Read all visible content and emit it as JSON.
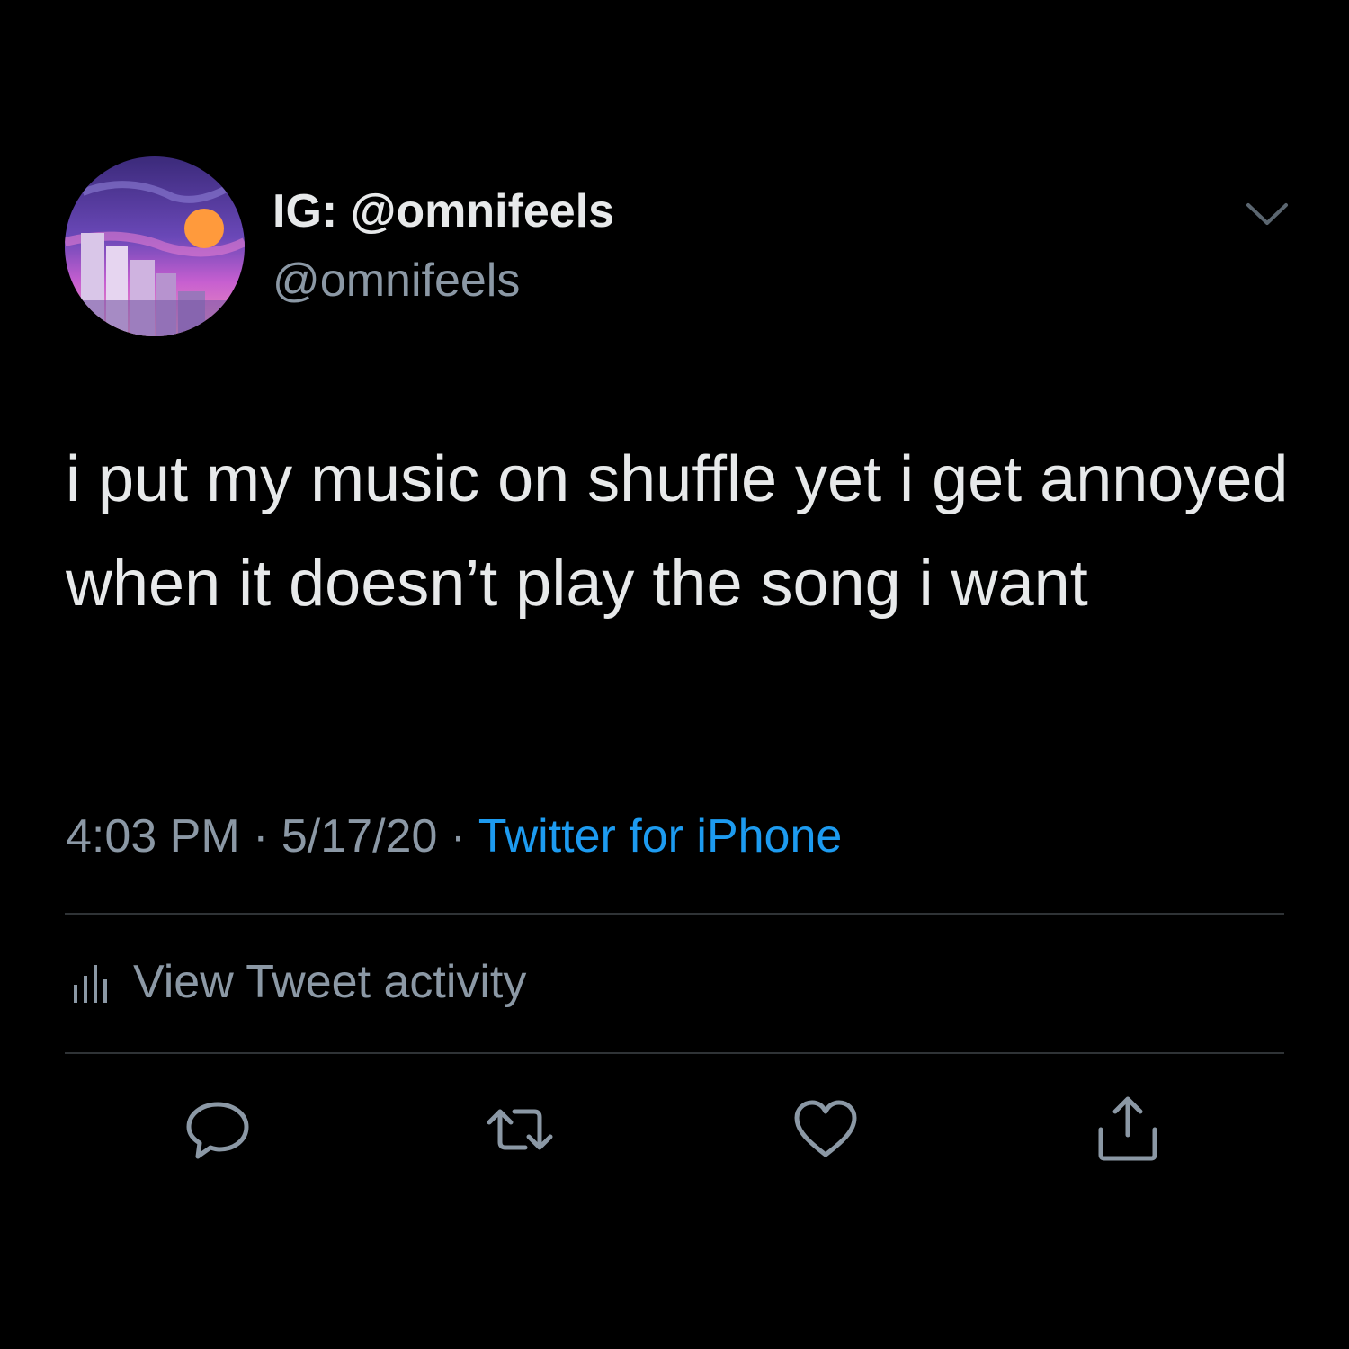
{
  "tweet": {
    "display_name": "IG: @omnifeels",
    "handle": "@omnifeels",
    "text": "i put my music on shuffle yet i get annoyed when it doesn’t play the song i want",
    "time": "4:03 PM",
    "separator": "·",
    "date": "5/17/20",
    "source": "Twitter for iPhone",
    "activity_label": "View Tweet activity"
  },
  "icons": {
    "menu": "chevron-down-icon",
    "activity": "bar-chart-icon",
    "reply": "reply-icon",
    "retweet": "retweet-icon",
    "like": "heart-icon",
    "share": "share-icon"
  },
  "colors": {
    "background": "#000000",
    "primary_text": "#e7e9ea",
    "secondary_text": "#8b98a5",
    "accent": "#1d9bf0",
    "divider": "#2f3336"
  }
}
